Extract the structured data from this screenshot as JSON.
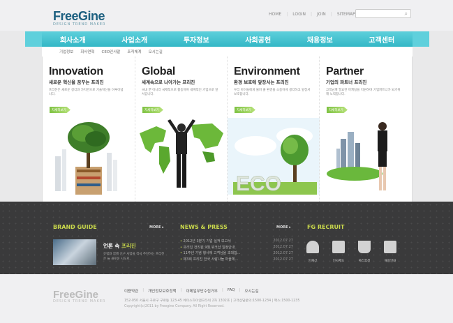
{
  "brand": {
    "name": "FreeGine",
    "tagline": "DESIGN TREND MAKER"
  },
  "top_links": [
    "HOME",
    "LOGIN",
    "JOIN",
    "SITEMAP"
  ],
  "nav": [
    "회사소개",
    "사업소개",
    "투자정보",
    "사회공헌",
    "채용정보",
    "고객센터"
  ],
  "subnav": [
    "기업정보",
    "회사연혁",
    "CEO인사말",
    "조직체계",
    "오시는길"
  ],
  "columns": [
    {
      "title": "Innovation",
      "subtitle": "새로운 혁신을 꿈꾸는 프리진",
      "desc": "프리진은 새로운 생각과 가치관으로 기술혁신을 이루어냅니다.",
      "more": "자세히보기"
    },
    {
      "title": "Global",
      "subtitle": "세계속으로 나아가는 프리진",
      "desc": "국내 뿐 아니라 국제적으로 활동하며 세계적인 기업으로 앞서갑니다.",
      "more": "자세히보기"
    },
    {
      "title": "Environment",
      "subtitle": "환경 보호에 앞장서는 프리진",
      "desc": "우리 아이들에게 물려 줄 환경을 소중하게 생각하고 앞장서 보호합니다.",
      "more": "자세히보기"
    },
    {
      "title": "Partner",
      "subtitle": "기업의 파트너 프리진",
      "desc": "고객님께 필요한 마케팅을 지원하며 기업파트너가 되기위해 노력합니다.",
      "more": "자세히보기"
    }
  ],
  "brand_guide": {
    "title": "BRAND GUIDE",
    "more": "MORE ▸",
    "headline_prefix": "언론 속 ",
    "headline_highlight": "프리진",
    "text": "유럽와 함께 선구 사업을 적극 추진하는 프리진은 늘 새로운 시도로.."
  },
  "news": {
    "title": "NEWS & PRESS",
    "more": "MORE ▸",
    "items": [
      {
        "title": "2012년 3분기 기업 실적 보고서",
        "date": "2012.07.27"
      },
      {
        "title": "프리진 전직원 9월 워크샵 일정안내",
        "date": "2012.07.27"
      },
      {
        "title": "11주년 기념 행사에 고객님을 초대합...",
        "date": "2012.07.27"
      },
      {
        "title": "제3회 프리진 전국 사랑나눔 마을체...",
        "date": "2012.07.27"
      }
    ]
  },
  "recruit": {
    "title": "FG RECRUIT",
    "items": [
      {
        "label": "인재상",
        "icon": "person-icon"
      },
      {
        "label": "인사제도",
        "icon": "document-icon"
      },
      {
        "label": "복리후생",
        "icon": "plant-icon"
      },
      {
        "label": "채용안내",
        "icon": "notice-icon"
      }
    ]
  },
  "footer": {
    "links": [
      "이용약관",
      "개인정보보호정책",
      "이메일무단수집거부",
      "FAQ",
      "오시는길"
    ],
    "address": "152-050 서울시 구로구 구로동 123-45 에이스하이엔드타워 2차 1302호 | 고객상담문의:1500-1234 | 팩스:1500-1235",
    "copyright": "Copyright(c)2011 by Freegine Company. All Right Reserved."
  }
}
